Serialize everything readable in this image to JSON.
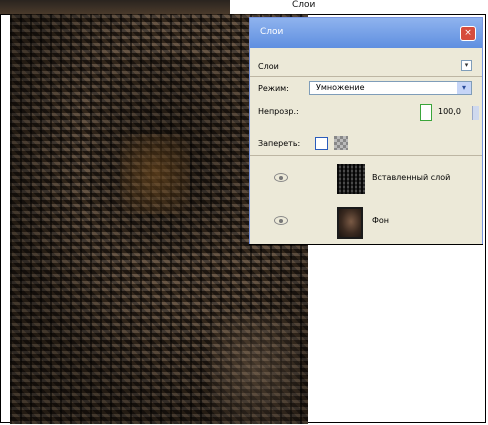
{
  "window": {
    "background_title": "Слои"
  },
  "panel": {
    "title": "Слои",
    "close_label": "×",
    "header_label": "Слои",
    "mini_dropdown": "▾",
    "mode_label": "Режим:",
    "mode_value": "Умножение",
    "mode_arrow": "▾",
    "opacity_label": "Непрозр.:",
    "opacity_value": "100,0",
    "lock_label": "Запереть:",
    "layers": [
      {
        "name": "Вставленный слой",
        "visible": true,
        "thumbnail": "pattern"
      },
      {
        "name": "Фон",
        "visible": true,
        "thumbnail": "photo"
      }
    ]
  },
  "colors": {
    "titlebar": "#6f9be6",
    "panel_bg": "#ece9d8",
    "close": "#d64c3c"
  }
}
